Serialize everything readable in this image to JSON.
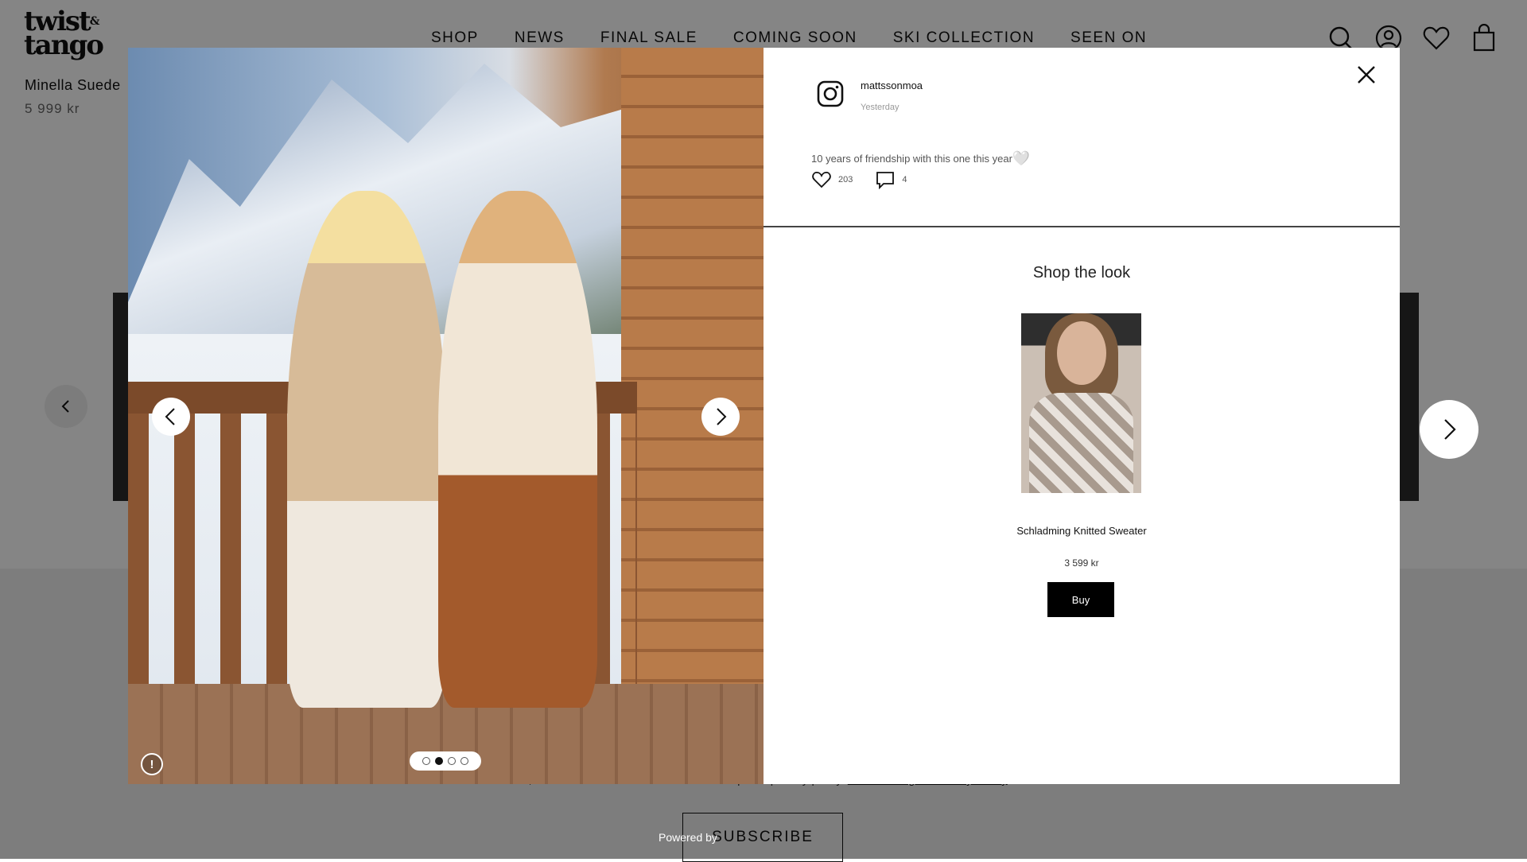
{
  "brand": {
    "logo_line1": "twist",
    "logo_amp": "&",
    "logo_line2": "tango"
  },
  "nav": [
    "SHOP",
    "NEWS",
    "FINAL SALE",
    "COMING SOON",
    "SKI COLLECTION",
    "SEEN ON"
  ],
  "header_icons": [
    "search-icon",
    "account-icon",
    "wishlist-icon",
    "bag-icon"
  ],
  "background_product": {
    "title": "Minella Suede",
    "price": "5 999 kr"
  },
  "newsletter": {
    "consent_text": "Yes, I want to receive newsletters and accept the privacy policy.",
    "policy_link": "Twist & Tango's Privacy Policy",
    "subscribe_label": "SUBSCRIBE"
  },
  "powered_by": "Powered by",
  "modal": {
    "post": {
      "username": "mattssonmoa",
      "timestamp": "Yesterday",
      "caption": "10 years of friendship with this one this year",
      "caption_emoji": "🤍",
      "likes": "203",
      "comments": "4"
    },
    "carousel": {
      "slides": 4,
      "active_index": 1
    },
    "shop_the_look": {
      "title": "Shop the look",
      "product_name": "Schladming Knitted Sweater",
      "product_price": "3 599 kr",
      "buy_label": "Buy"
    },
    "info_label": "!"
  },
  "colors": {
    "overlay": "rgba(0,0,0,0.48)",
    "button_dark": "#000000",
    "panel_bg": "#ffffff"
  }
}
